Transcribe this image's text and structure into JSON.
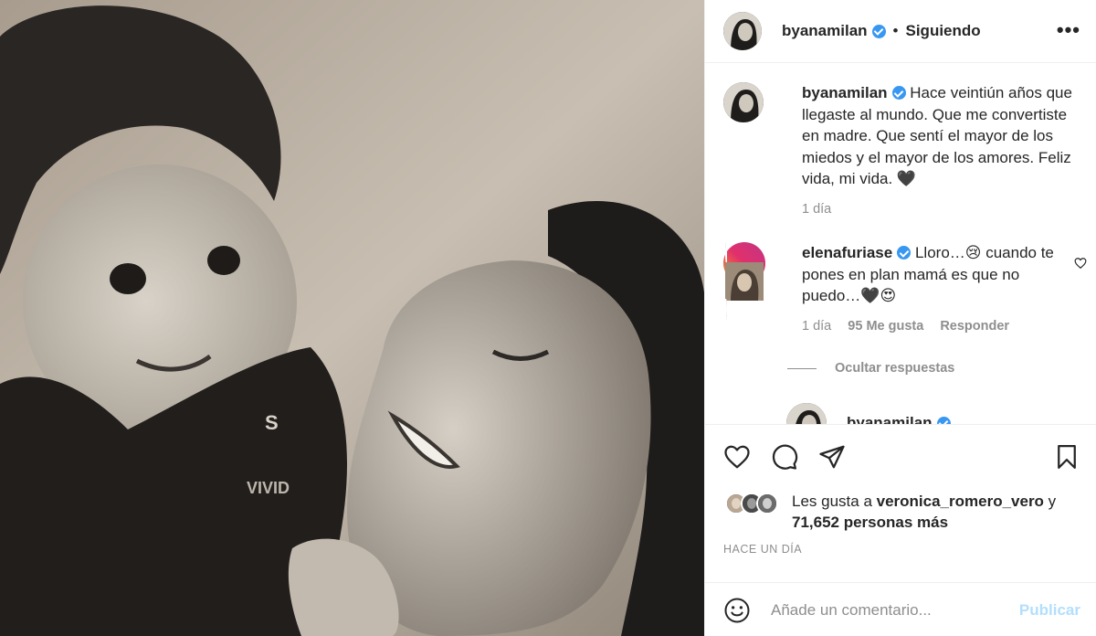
{
  "post": {
    "author": "byanamilan",
    "separator": "•",
    "follow_label": "Siguiendo",
    "more_label": "•••"
  },
  "caption": {
    "username": "byanamilan",
    "text": "Hace veintiún años que llegaste al mundo. Que me convertiste en madre. Que sentí el mayor de los miedos y el mayor de los amores. Feliz vida, mi vida. 🖤",
    "time": "1 día"
  },
  "comment": {
    "username": "elenafuriase",
    "text": "Lloro…😢 cuando te pones en plan mamá es que no puedo…🖤😍",
    "time": "1 día",
    "likes": "95 Me gusta",
    "reply_label": "Responder"
  },
  "replies": {
    "toggle_label": "Ocultar respuestas",
    "first_username": "byanamilan",
    "first_more": "..."
  },
  "likes": {
    "prefix": "Les gusta a ",
    "user": "veronica_romero_vero",
    "suffix": " y",
    "count_text": "71,652 personas más"
  },
  "timestamp": "HACE UN DÍA",
  "add_comment": {
    "placeholder": "Añade un comentario...",
    "publish_label": "Publicar"
  },
  "icons": {
    "like": "heart-icon",
    "comment": "comment-icon",
    "share": "share-icon",
    "save": "bookmark-icon",
    "emoji": "emoji-icon",
    "verified": "verified-badge-icon"
  },
  "colors": {
    "verified": "#3897f0",
    "publish_disabled": "#b2dffc",
    "secondary_text": "#8e8e8e"
  }
}
